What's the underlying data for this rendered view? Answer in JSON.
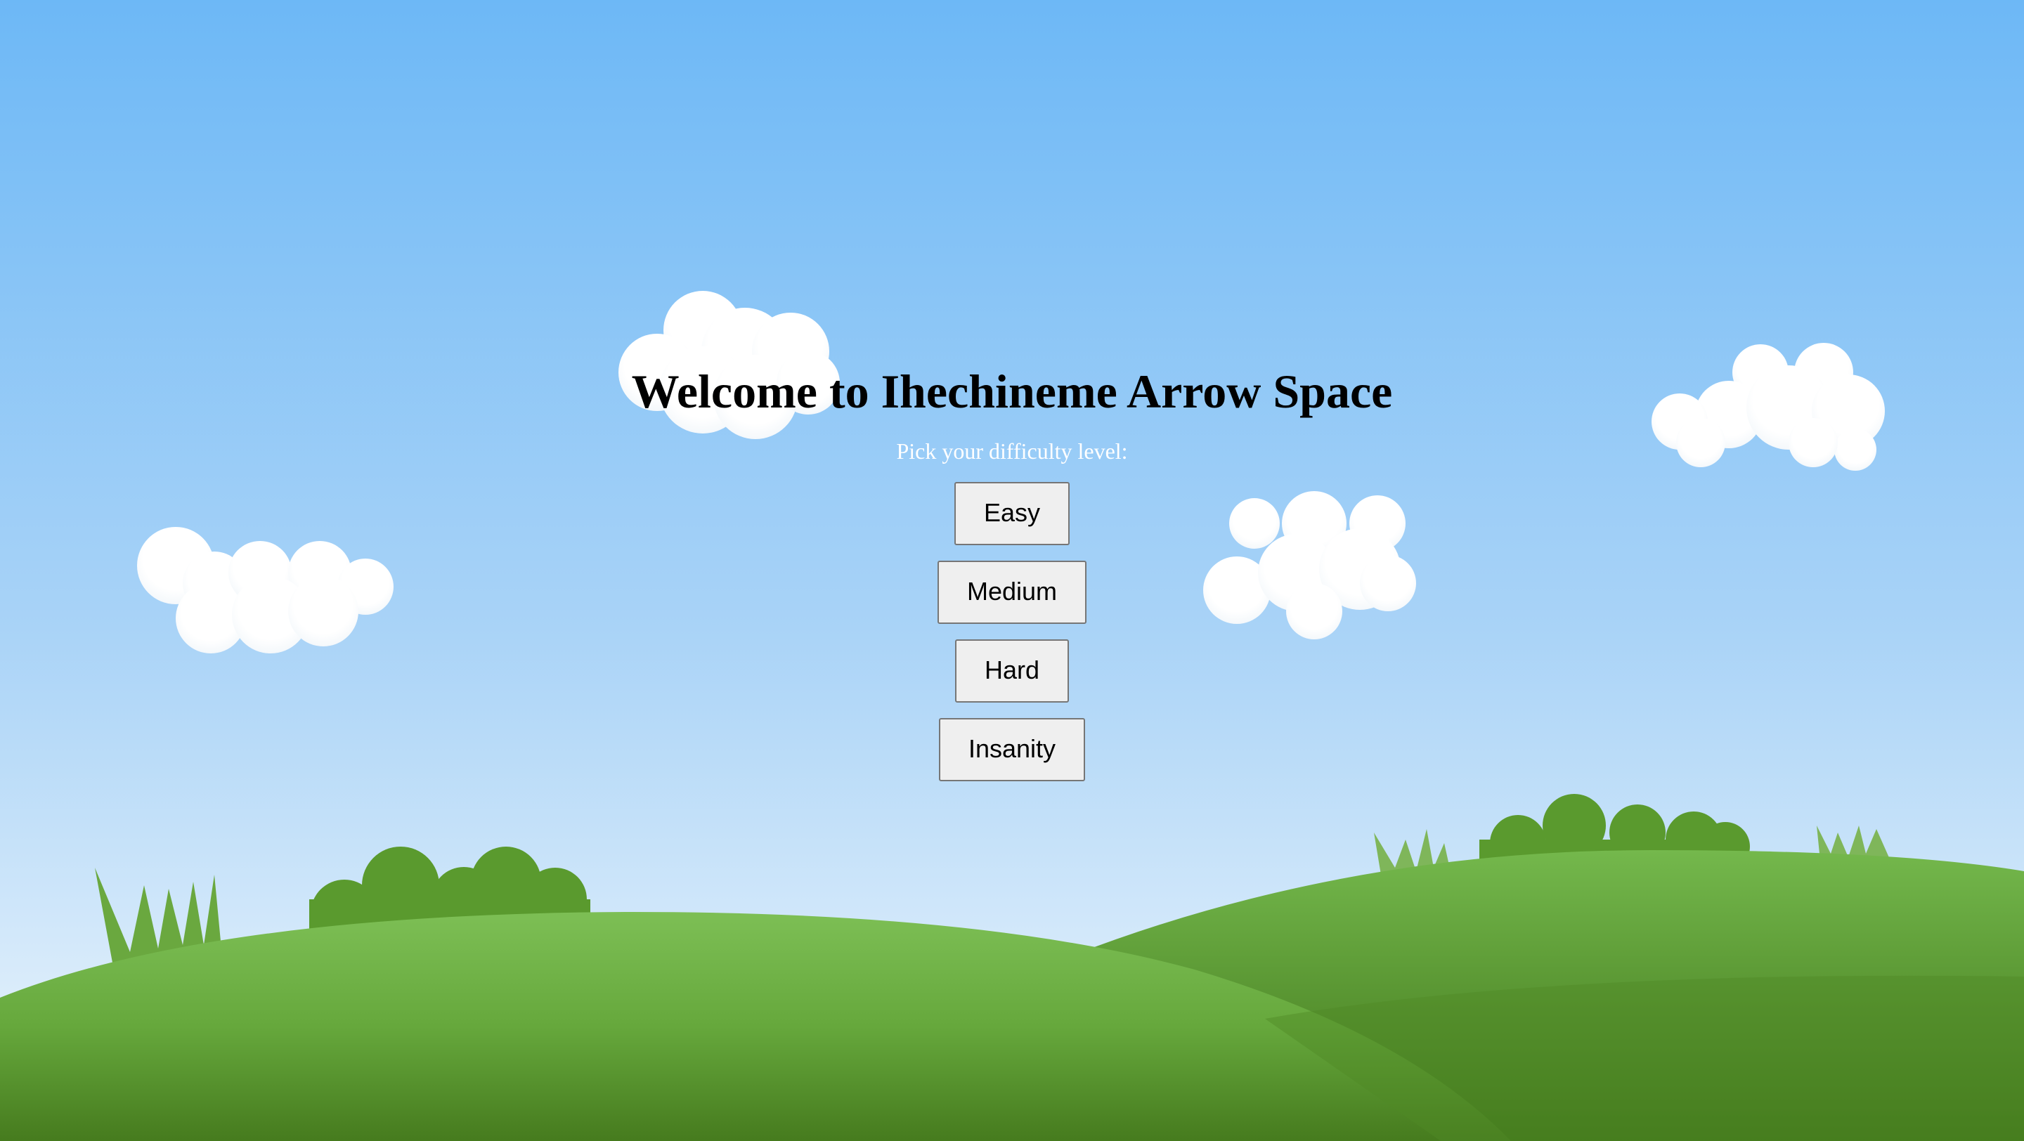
{
  "page": {
    "title": "Welcome to Ihechineme Arrow Space",
    "subtitle": "Pick your difficulty level:"
  },
  "difficulty_buttons": [
    {
      "label": "Easy"
    },
    {
      "label": "Medium"
    },
    {
      "label": "Hard"
    },
    {
      "label": "Insanity"
    }
  ],
  "colors": {
    "sky_top": "#6db8f6",
    "sky_bottom": "#e6f2fb",
    "hill_light": "#7dbf55",
    "hill_dark": "#4a7d22",
    "bush": "#5a9a2e",
    "cloud": "#ffffff",
    "subtitle_text": "#ffffff",
    "title_text": "#000000",
    "button_bg": "#efefef",
    "button_border": "#767676"
  }
}
